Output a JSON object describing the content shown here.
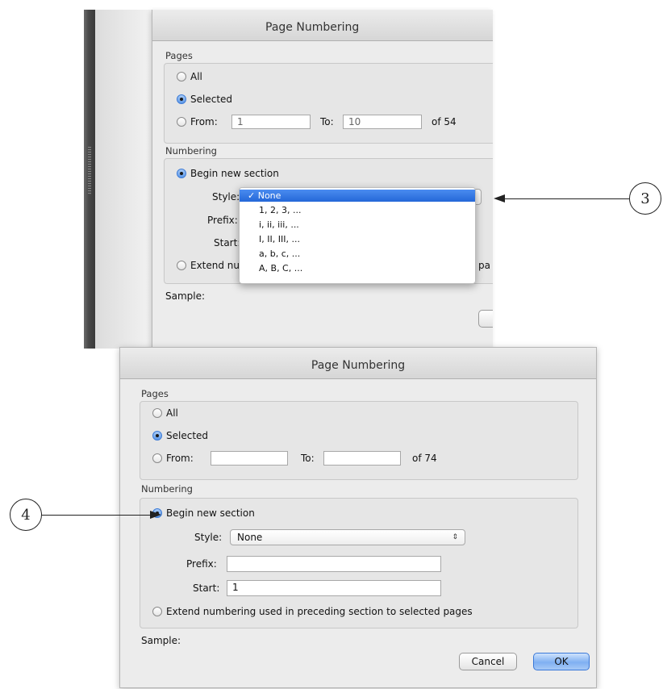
{
  "top_dialog": {
    "title": "Page Numbering",
    "pages_group": "Pages",
    "opt_all": "All",
    "opt_selected": "Selected",
    "opt_from": "From:",
    "from_value": "1",
    "to_label": "To:",
    "to_value": "10",
    "of_total": "of 54",
    "numbering_group": "Numbering",
    "begin_new_section": "Begin new section",
    "style_label": "Style:",
    "prefix_label": "Prefix:",
    "start_label": "Start:",
    "extend_label": "Extend nu",
    "extend_tail": "pa",
    "sample_label": "Sample:",
    "style_menu": {
      "options": [
        "None",
        "1, 2, 3, ...",
        "i, ii, iii, ...",
        "I, II, III, ...",
        "a, b, c, ...",
        "A, B, C, ..."
      ],
      "selected_prefix": "✓",
      "selected": "None"
    }
  },
  "callouts": {
    "three": "3",
    "four": "4"
  },
  "bottom_dialog": {
    "title": "Page Numbering",
    "pages_group": "Pages",
    "opt_all": "All",
    "opt_selected": "Selected",
    "opt_from": "From:",
    "from_value": "",
    "to_label": "To:",
    "to_value": "",
    "of_total": "of 74",
    "numbering_group": "Numbering",
    "begin_new_section": "Begin new section",
    "style_label": "Style:",
    "style_value": "None",
    "style_arrows": "⇕",
    "prefix_label": "Prefix:",
    "prefix_value": "",
    "start_label": "Start:",
    "start_value": "1",
    "extend_label": "Extend numbering used in preceding section to selected pages",
    "sample_label": "Sample:",
    "cancel_button": "Cancel",
    "ok_button": "OK"
  },
  "colors": {
    "accent": "#2467d8",
    "window_bg": "#ececec"
  }
}
